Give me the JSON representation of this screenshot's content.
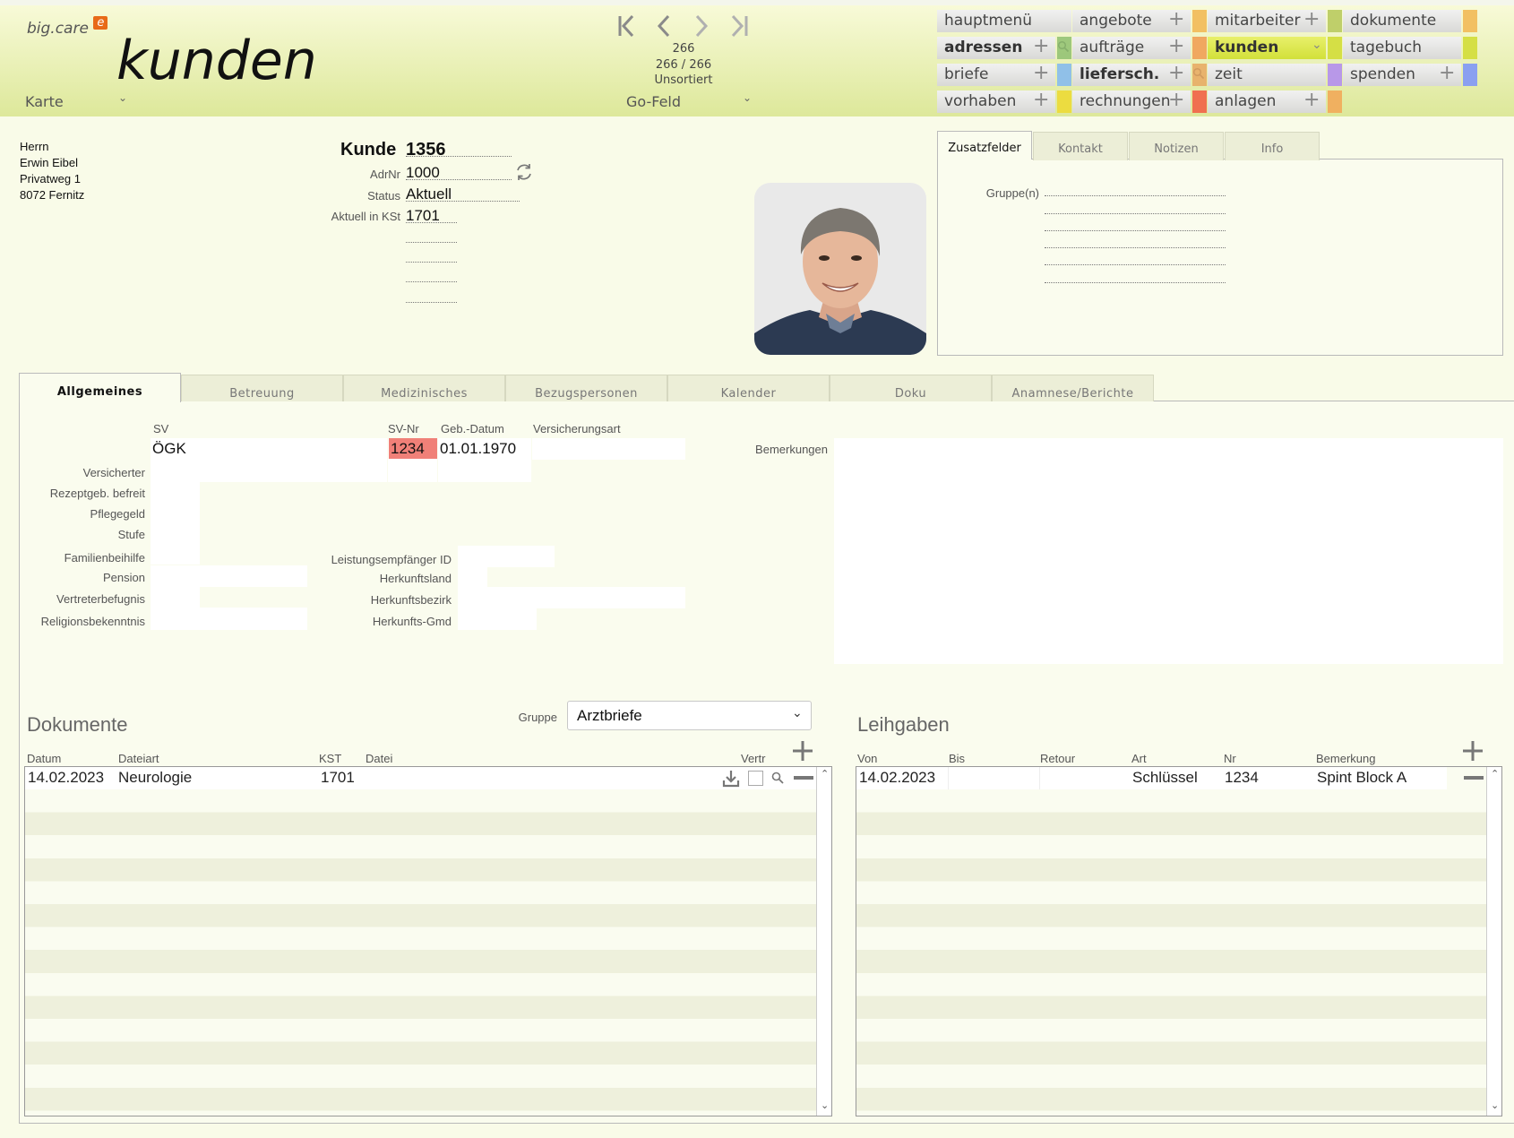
{
  "header": {
    "brand": "big.care",
    "brand_badge": "e",
    "title": "kunden",
    "view_label": "Karte",
    "record_current": "266",
    "record_position": "266 / 266",
    "sort_label": "Unsortiert",
    "go_field_label": "Go-Feld"
  },
  "menu": [
    {
      "label": "hauptmenü"
    },
    {
      "label": "angebote",
      "plus": true,
      "color": "#f2c062"
    },
    {
      "label": "mitarbeiter",
      "plus": true,
      "color": "#bfcf6a"
    },
    {
      "label": "dokumente",
      "color": "#f2c062"
    },
    {
      "label": "adressen",
      "plus": true,
      "color": "#8fc070",
      "bold": true
    },
    {
      "label": "aufträge",
      "plus": true,
      "color": "#f0a860"
    },
    {
      "label": "kunden",
      "color": "#d5df45",
      "bold": true,
      "active": true
    },
    {
      "label": "tagebuch",
      "color": "#d5df45"
    },
    {
      "label": "briefe",
      "plus": true,
      "color": "#90c0e8"
    },
    {
      "label": "liefersch.",
      "plus": true,
      "color": "#e8a860",
      "bold": true
    },
    {
      "label": "zeit",
      "color": "#b898e8"
    },
    {
      "label": "spenden",
      "plus": true,
      "color": "#8aa0f0"
    },
    {
      "label": "vorhaben",
      "plus": true,
      "color": "#ecdc40"
    },
    {
      "label": "rechnungen",
      "plus": true,
      "color": "#f07050"
    },
    {
      "label": "anlagen",
      "plus": true,
      "color": "#f0b060"
    }
  ],
  "address": {
    "line1": "Herrn",
    "line2": "Erwin Eibel",
    "line3": "Privatweg 1",
    "line4": "8072 Fernitz"
  },
  "record": {
    "kunde_label": "Kunde",
    "kunde_nr": "1356",
    "adrnr_label": "AdrNr",
    "adrnr": "1000",
    "status_label": "Status",
    "status": "Aktuell",
    "kst_label": "Aktuell in KSt",
    "kst": "1701"
  },
  "zusatz": {
    "tabs": [
      "Zusatzfelder",
      "Kontakt",
      "Notizen",
      "Info"
    ],
    "gruppe_label": "Gruppe(n)"
  },
  "form_tabs": [
    "Allgemeines",
    "Betreuung",
    "Medizinisches",
    "Bezugspersonen",
    "Kalender",
    "Doku",
    "Anamnese/Berichte"
  ],
  "allgemein": {
    "sv_label": "SV",
    "sv": "ÖGK",
    "svnr_label": "SV-Nr",
    "svnr": "1234",
    "gebdatum_label": "Geb.-Datum",
    "gebdatum": "01.01.1970",
    "versicherungsart_label": "Versicherungsart",
    "bemerkungen_label": "Bemerkungen",
    "versicherter_label": "Versicherter",
    "rezeptgeb_label": "Rezeptgeb. befreit",
    "pflegegeld_label": "Pflegegeld",
    "stufe_label": "Stufe",
    "familienbeihilfe_label": "Familienbeihilfe",
    "pension_label": "Pension",
    "vertreter_label": "Vertreterbefugnis",
    "religion_label": "Religionsbekenntnis",
    "leistungsempfaenger_label": "Leistungsempfänger ID",
    "herkunftsland_label": "Herkunftsland",
    "herkunftsbezirk_label": "Herkunftsbezirk",
    "herkunftsgmd_label": "Herkunfts-Gmd",
    "sv_nr_color": "#f08078"
  },
  "dokumente": {
    "title": "Dokumente",
    "gruppe_label": "Gruppe",
    "gruppe_value": "Arztbriefe",
    "columns": [
      "Datum",
      "Dateiart",
      "KST",
      "Datei",
      "Vertr"
    ],
    "rows": [
      {
        "datum": "14.02.2023",
        "dateiart": "Neurologie",
        "kst": "1701",
        "datei": ""
      }
    ]
  },
  "leihgaben": {
    "title": "Leihgaben",
    "columns": [
      "Von",
      "Bis",
      "Retour",
      "Art",
      "Nr",
      "Bemerkung"
    ],
    "rows": [
      {
        "von": "14.02.2023",
        "bis": "",
        "retour": "",
        "art": "Schlüssel",
        "nr": "1234",
        "bemerkung": "Spint Block A"
      }
    ]
  }
}
